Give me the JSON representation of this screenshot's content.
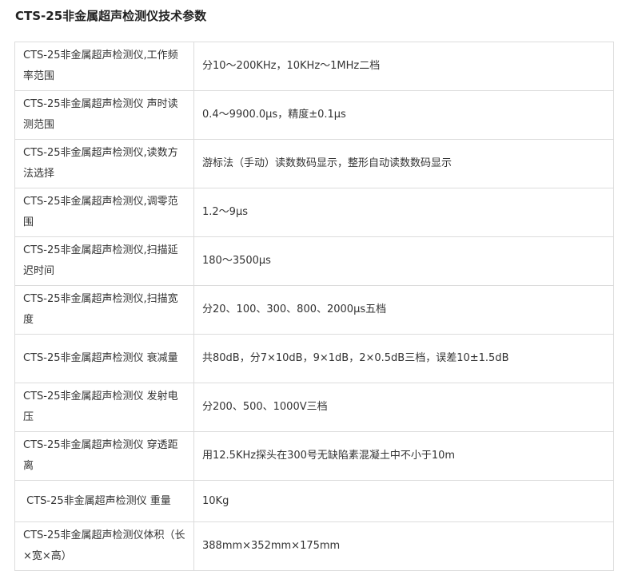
{
  "title": "CTS-25非金属超声检测仪技术参数",
  "rows": [
    {
      "param": "CTS-25非金属超声检测仪,工作频率范围",
      "value": "分10～200KHz，10KHz～1MHz二档"
    },
    {
      "param": "CTS-25非金属超声检测仪 声时读测范围",
      "value": "0.4～9900.0μs，精度±0.1μs"
    },
    {
      "param": "CTS-25非金属超声检测仪,读数方法选择",
      "value": "游标法（手动）读数数码显示，整形自动读数数码显示"
    },
    {
      "param": "CTS-25非金属超声检测仪,调零范围",
      "value": "1.2～9μs"
    },
    {
      "param": "CTS-25非金属超声检测仪,扫描延迟时间",
      "value": "180～3500μs"
    },
    {
      "param": "CTS-25非金属超声检测仪,扫描宽度",
      "value": "分20、100、300、800、2000μs五档"
    },
    {
      "param": "CTS-25非金属超声检测仪 衰减量",
      "value": "共80dB，分7×10dB，9×1dB，2×0.5dB三档，误差10±1.5dB"
    },
    {
      "param": "CTS-25非金属超声检测仪 发射电压",
      "value": "分200、500、1000V三档"
    },
    {
      "param": "CTS-25非金属超声检测仪 穿透距离",
      "value": "用12.5KHz探头在300号无缺陷素混凝土中不小于10m"
    },
    {
      "param": " CTS-25非金属超声检测仪 重量",
      "value": "10Kg"
    },
    {
      "param": "CTS-25非金属超声检测仪体积（长×宽×高）",
      "value": "388mm×352mm×175mm"
    }
  ]
}
